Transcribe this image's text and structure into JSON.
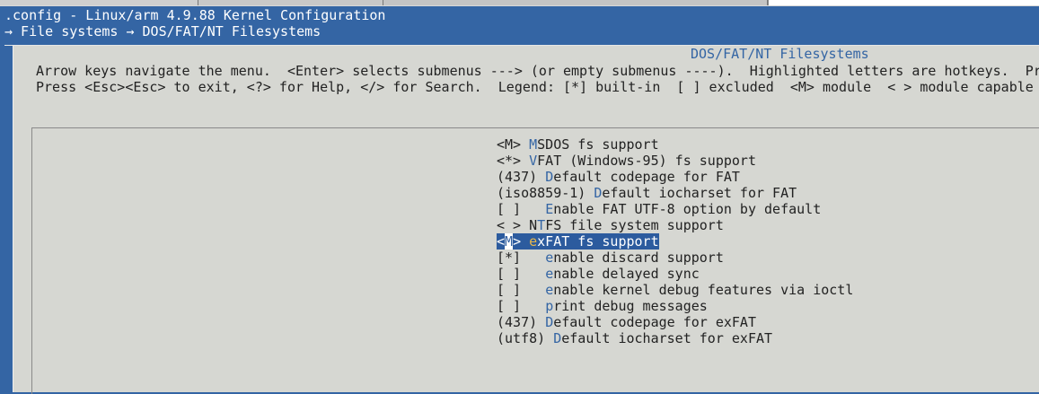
{
  "terminal": {
    "title": ".config - Linux/arm 4.9.88 Kernel Configuration",
    "breadcrumb": "→ File systems → DOS/FAT/NT Filesystems"
  },
  "dialog": {
    "title": "DOS/FAT/NT Filesystems",
    "help_line1": "Arrow keys navigate the menu.  <Enter> selects submenus ---> (or empty submenus ----).  Highlighted letters are hotkeys.  Pr",
    "help_line2": "Press <Esc><Esc> to exit, <?> for Help, </> for Search.  Legend: [*] built-in  [ ] excluded  <M> module  < > module capable"
  },
  "menu": {
    "items": [
      {
        "prefix": "<M> ",
        "hotkey": "M",
        "rest": "SDOS fs support"
      },
      {
        "prefix": "<*> ",
        "hotkey": "V",
        "rest": "FAT (Windows-95) fs support"
      },
      {
        "prefix": "(437) ",
        "hotkey": "D",
        "rest": "efault codepage for FAT"
      },
      {
        "prefix": "(iso8859-1) ",
        "hotkey": "D",
        "rest": "efault iocharset for FAT"
      },
      {
        "prefix": "[ ]   ",
        "hotkey": "E",
        "rest": "nable FAT UTF-8 option by default"
      },
      {
        "prefix": "< > N",
        "hotkey": "T",
        "rest": "FS file system support"
      },
      {
        "prefix_a": "<",
        "prefix_hk": "M",
        "prefix_b": "> ",
        "hotkey": "e",
        "rest": "xFAT fs support",
        "selected": true
      },
      {
        "prefix": "[*]   ",
        "hotkey": "e",
        "rest": "nable discard support"
      },
      {
        "prefix": "[ ]   ",
        "hotkey": "e",
        "rest": "nable delayed sync"
      },
      {
        "prefix": "[ ]   ",
        "hotkey": "e",
        "rest": "nable kernel debug features via ioctl"
      },
      {
        "prefix": "[ ]   ",
        "hotkey": "p",
        "rest": "rint debug messages"
      },
      {
        "prefix": "(437) ",
        "hotkey": "D",
        "rest": "efault codepage for exFAT"
      },
      {
        "prefix": "(utf8) ",
        "hotkey": "D",
        "rest": "efault iocharset for exFAT"
      }
    ]
  },
  "colors": {
    "background": "#3465a4",
    "dialog": "#d6d7d2",
    "hotkey": "#3465a4",
    "selection": "#2c5b9e"
  }
}
